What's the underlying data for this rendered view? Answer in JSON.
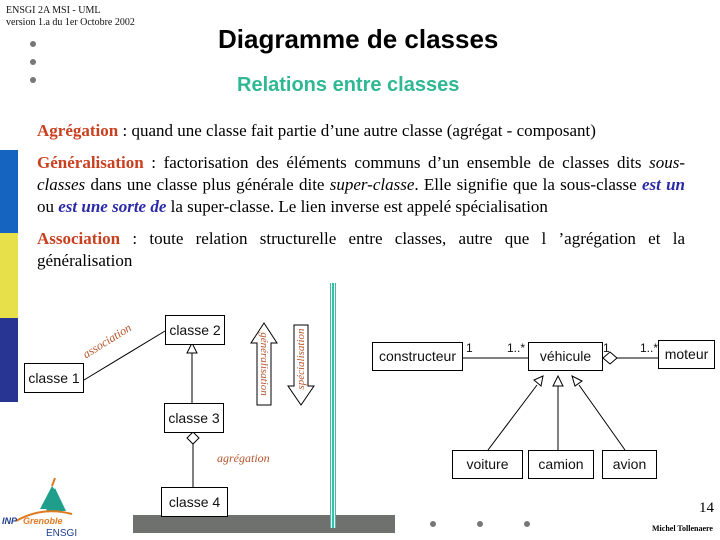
{
  "header": {
    "line1": "ENSGI 2A MSI - UML",
    "line2": "version 1.a  du 1er Octobre 2002"
  },
  "title": "Diagramme de classes",
  "subtitle": "Relations entre classes",
  "paragraphs": {
    "agregation": {
      "term": "Agrégation",
      "text": " : quand une classe fait partie d’une autre classe (agrégat - composant)"
    },
    "generalisation": {
      "term": "Généralisation",
      "text1": " : factorisation des éléments communs d’un ensemble de classes dits ",
      "ital1": "sous-classes",
      "text2": " dans une classe plus générale dite ",
      "ital2": "super-classe",
      "text3": ". Elle signifie que la sous-classe ",
      "emph1": "est un",
      "text4": " ou ",
      "emph2": "est une sorte de",
      "text5": " la super-classe. Le lien inverse est appelé spécialisation"
    },
    "association": {
      "term": "Association",
      "text": " : toute relation structurelle entre classes, autre que l ’agrégation et la généralisation"
    }
  },
  "diagram_left": {
    "classes": [
      "classe 1",
      "classe 2",
      "classe 3",
      "classe 4"
    ],
    "labels": {
      "association": "association",
      "generalisation": "généralisation",
      "specialisation": "spécialisation",
      "aggregation": "agrégation"
    }
  },
  "diagram_right": {
    "classes": {
      "constructeur": "constructeur",
      "vehicule": "véhicule",
      "moteur": "moteur",
      "voiture": "voiture",
      "camion": "camion",
      "avion": "avion"
    },
    "multiplicities": {
      "constructeur_end": "1",
      "vehicule_end_left": "1..*",
      "vehicule_end_right": "1",
      "moteur_end": "1..*"
    }
  },
  "footer": {
    "page_number": "14",
    "author": "Michel Tollenaere",
    "logo_text1": "INP",
    "logo_text2": "Grenoble",
    "logo_text3": "ENSGI"
  },
  "colors": {
    "term": "#c8401f",
    "emphasis": "#2a2aa8",
    "subtitle": "#2fb893",
    "bar_blue": "#1565c0",
    "bar_yellow": "#e8e04a",
    "bar_navy": "#283593",
    "gray_bar": "#6e716d",
    "teal_line": "#3cbfa8"
  }
}
